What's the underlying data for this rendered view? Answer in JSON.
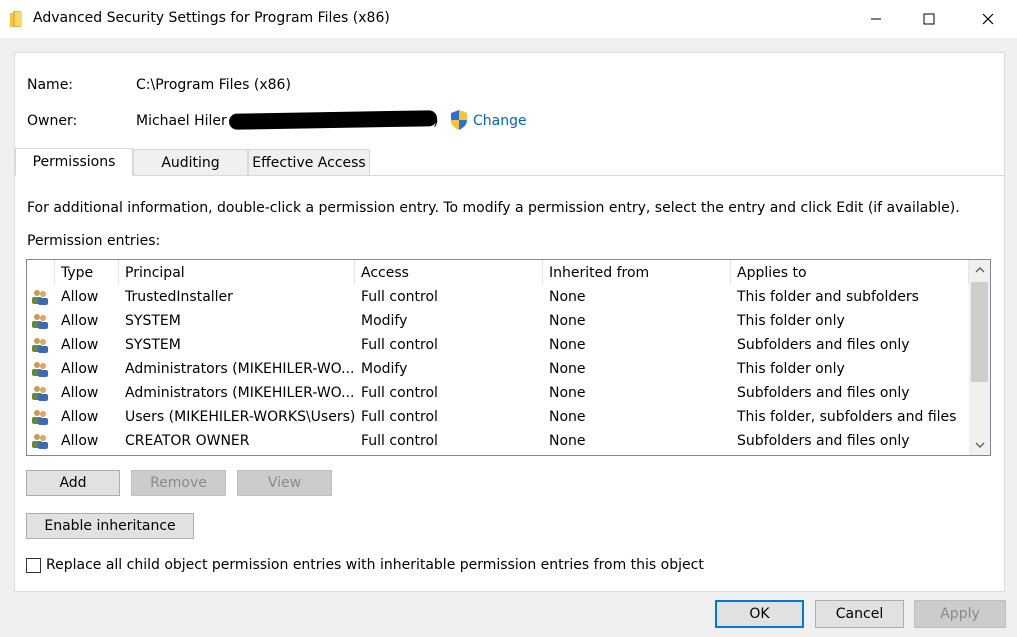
{
  "window": {
    "title": "Advanced Security Settings for Program Files (x86)",
    "icon": "folder-icon",
    "controls": [
      "minimize-icon",
      "maximize-icon",
      "close-icon"
    ]
  },
  "object": {
    "name_label": "Name:",
    "name_value": "C:\\Program Files (x86)",
    "owner_label": "Owner:",
    "owner_value": "Michael Hiler (",
    "owner_value_end": ")",
    "change_label": "Change"
  },
  "tabs": [
    {
      "label": "Permissions",
      "active": true
    },
    {
      "label": "Auditing",
      "active": false
    },
    {
      "label": "Effective Access",
      "active": false
    }
  ],
  "permissions": {
    "info_text": "For additional information, double-click a permission entry. To modify a permission entry, select the entry and click Edit (if available).",
    "entries_label": "Permission entries:",
    "columns": [
      "Type",
      "Principal",
      "Access",
      "Inherited from",
      "Applies to"
    ],
    "rows": [
      {
        "type": "Allow",
        "principal": "TrustedInstaller",
        "access": "Full control",
        "inherited": "None",
        "applies": "This folder and subfolders"
      },
      {
        "type": "Allow",
        "principal": "SYSTEM",
        "access": "Modify",
        "inherited": "None",
        "applies": "This folder only"
      },
      {
        "type": "Allow",
        "principal": "SYSTEM",
        "access": "Full control",
        "inherited": "None",
        "applies": "Subfolders and files only"
      },
      {
        "type": "Allow",
        "principal": "Administrators (MIKEHILER-WO...",
        "access": "Modify",
        "inherited": "None",
        "applies": "This folder only"
      },
      {
        "type": "Allow",
        "principal": "Administrators (MIKEHILER-WO...",
        "access": "Full control",
        "inherited": "None",
        "applies": "Subfolders and files only"
      },
      {
        "type": "Allow",
        "principal": "Users (MIKEHILER-WORKS\\Users)",
        "access": "Full control",
        "inherited": "None",
        "applies": "This folder, subfolders and files"
      },
      {
        "type": "Allow",
        "principal": "CREATOR OWNER",
        "access": "Full control",
        "inherited": "None",
        "applies": "Subfolders and files only"
      }
    ]
  },
  "buttons": {
    "add": "Add",
    "remove": "Remove",
    "view": "View",
    "enable_inheritance": "Enable inheritance",
    "ok": "OK",
    "cancel": "Cancel",
    "apply": "Apply"
  },
  "replace_checkbox": {
    "label": "Replace all child object permission entries with inheritable permission entries from this object",
    "checked": false
  },
  "colors": {
    "link": "#0066cc",
    "focus_border": "#0078d7"
  }
}
